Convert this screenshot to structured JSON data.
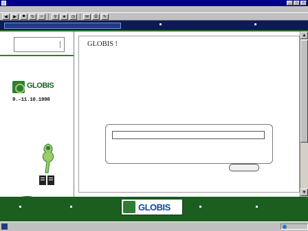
{
  "browser": {
    "title": "",
    "menus": [],
    "toolbar_icons": [
      "back-icon",
      "forward-icon",
      "stop-icon",
      "refresh-icon",
      "home-icon",
      "search-icon",
      "favorites-icon",
      "history-icon",
      "mail-icon",
      "print-icon",
      "edit-icon"
    ],
    "status_text": "",
    "zone_label": ""
  },
  "site_nav": {
    "breadcrumb": "",
    "links": [
      "",
      ""
    ]
  },
  "left_frame": {
    "language_label": "",
    "sponsor_text": "",
    "logo_word": "GLOBIS",
    "logo_subtitle": "",
    "event_date": "9.–11.10.1998"
  },
  "main": {
    "title": "GLOBIS !",
    "intro_paragraph": "",
    "instruction": "",
    "input_value": "",
    "form_note": "",
    "submit_label": "",
    "footer_note": ""
  },
  "footer": {
    "links": [
      "",
      "",
      "",
      ""
    ],
    "logo_word": "GLOBIS"
  },
  "colors": {
    "title_bar": "#000080",
    "site_nav_bg": "#0c1a5a",
    "accent_green": "#2e7d32",
    "footer_green": "#1b5e20"
  }
}
